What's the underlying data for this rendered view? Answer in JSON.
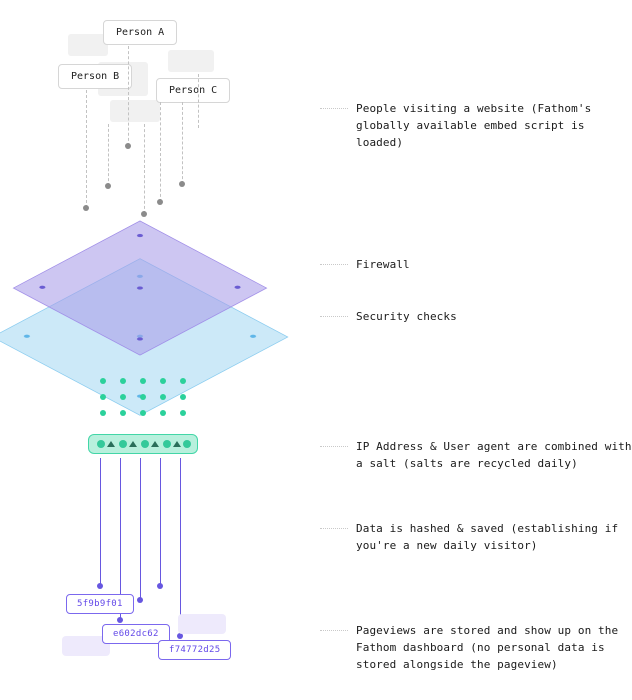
{
  "people": {
    "a": "Person A",
    "b": "Person B",
    "c": "Person C"
  },
  "annotations": {
    "people_visiting": "People visiting a website (Fathom's globally available embed script is loaded)",
    "firewall": "Firewall",
    "security_checks": "Security checks",
    "ip_salt": "IP Address & User agent are combined with a salt (salts are recycled daily)",
    "hashed": "Data is hashed & saved (establishing if you're a new daily visitor)",
    "pageviews": "Pageviews are stored and show up on the Fathom dashboard (no personal data is stored alongside the pageview)"
  },
  "hashes": {
    "h1": "5f9b9f01",
    "h2": "e602dc62",
    "h3": "f74772d25"
  },
  "colors": {
    "firewall_fill": "#a89ce8",
    "security_fill": "#a7d9f3",
    "green": "#34c99a",
    "purple": "#6757e0"
  }
}
